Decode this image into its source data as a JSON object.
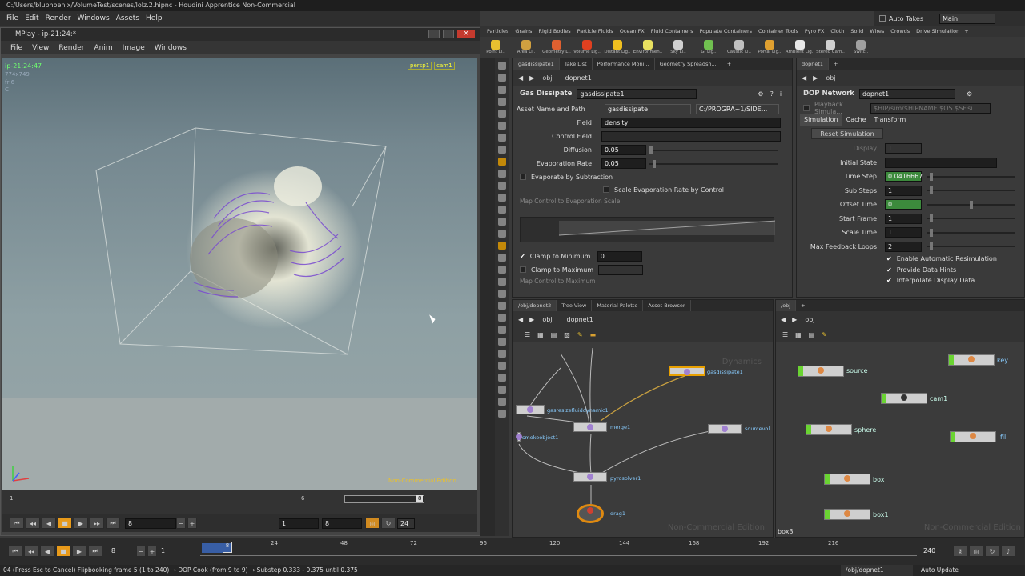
{
  "window": {
    "title": "C:/Users/bluphoenix/VolumeTest/scenes/lolz.2.hipnc - Houdini Apprentice Non-Commercial"
  },
  "menu": [
    "File",
    "Edit",
    "Render",
    "Windows",
    "Assets",
    "Help"
  ],
  "takes": {
    "auto_takes": "Auto Takes",
    "desktop": "Main"
  },
  "shelf_tabs": [
    "Particles",
    "Grains",
    "Rigid Bodies",
    "Particle Fluids",
    "Ocean FX",
    "Fluid Containers",
    "Populate Containers",
    "Container Tools",
    "Pyro FX",
    "Cloth",
    "Solid",
    "Wires",
    "Crowds",
    "Drive Simulation"
  ],
  "shelf_tools": [
    "Point Li..",
    "Area Li..",
    "Geometry L..",
    "Volume Lig..",
    "Distant Lig..",
    "Environmen..",
    "Sky Li..",
    "GI Lig..",
    "Caustic Li..",
    "Portal Lig..",
    "Ambient Lig..",
    "Stereo Cam..",
    "Switc.."
  ],
  "mplay": {
    "title": "MPlay - ip-21:24:*",
    "menu": [
      "File",
      "View",
      "Render",
      "Anim",
      "Image",
      "Windows"
    ],
    "viewport": {
      "image_name": "ip-21:24:47",
      "resolution": "774x749",
      "frame": "fr 6",
      "channel": "C",
      "persp": "persp1",
      "cam": "cam1",
      "watermark": "Non-Commercial Edition"
    },
    "timeline": {
      "start": "1",
      "mid": "6",
      "end_marker": "8"
    },
    "controls": {
      "frame": "8",
      "range_start": "1",
      "range_end": "8",
      "fps": "24"
    }
  },
  "parm_pane": {
    "tabs": [
      "gasdissipate1",
      "Take List",
      "Performance Moni...",
      "Geometry Spreadsh..."
    ],
    "path": {
      "root": "obj",
      "node": "dopnet1"
    },
    "node_type": "Gas Dissipate",
    "node_name": "gasdissipate1",
    "asset": {
      "label": "Asset Name and Path",
      "name": "gasdissipate",
      "path": "C:/PROGRA~1/SIDE..."
    },
    "parms": [
      {
        "label": "Field",
        "value": "density"
      },
      {
        "label": "Control Field",
        "value": ""
      },
      {
        "label": "Diffusion",
        "value": "0.05"
      },
      {
        "label": "Evaporation Rate",
        "value": "0.05"
      }
    ],
    "evap_subtraction": "Evaporate by Subtraction",
    "scale_evap": "Scale Evaporation Rate by Control",
    "map_evap": "Map Control to Evaporation Scale",
    "clamp_min": {
      "label": "Clamp to Minimum",
      "value": "0"
    },
    "clamp_max": {
      "label": "Clamp to Maximum",
      "value": ""
    },
    "map_max": "Map Control to Maximum"
  },
  "dop_pane": {
    "tab": "dopnet1",
    "path": {
      "root": "obj"
    },
    "node_type": "DOP Network",
    "node_name": "dopnet1",
    "playback": "Playback Simula...",
    "playback_path": "$HIP/sim/$HIPNAME.$OS.$SF.si",
    "tabs": [
      "Simulation",
      "Cache",
      "Transform"
    ],
    "reset": "Reset Simulation",
    "parms": [
      {
        "label": "Display",
        "value": "1"
      },
      {
        "label": "Initial State",
        "value": ""
      },
      {
        "label": "Time Step",
        "value": "0.0416667"
      },
      {
        "label": "Sub Steps",
        "value": "1"
      },
      {
        "label": "Offset Time",
        "value": "0"
      },
      {
        "label": "Start Frame",
        "value": "1"
      },
      {
        "label": "Scale Time",
        "value": "1"
      },
      {
        "label": "Max Feedback Loops",
        "value": "2"
      }
    ],
    "checks": [
      "Enable Automatic Resimulation",
      "Provide Data Hints",
      "Interpolate Display Data"
    ]
  },
  "net_left": {
    "tabs": [
      "/obj/dopnet2",
      "Tree View",
      "Material Palette",
      "Asset Browser"
    ],
    "path": {
      "root": "obj",
      "node": "dopnet1"
    },
    "context": "Dynamics",
    "watermark": "Non-Commercial Edition",
    "nodes": [
      "gasdissipate1",
      "gasresizefluiddynamic1",
      "smokeobject1",
      "merge1",
      "sourcevol",
      "pyrosolver1",
      "drag1"
    ]
  },
  "net_right": {
    "tab": "/obj",
    "path": {
      "root": "obj"
    },
    "watermark": "Non-Commercial Edition",
    "nodes": [
      "source",
      "key",
      "cam1",
      "sphere",
      "fill",
      "box",
      "box1"
    ],
    "bottom_label": "box3"
  },
  "timeline": {
    "frame": "8",
    "start": "1",
    "end": "240",
    "ticks": [
      "24",
      "48",
      "72",
      "96",
      "120",
      "144",
      "168",
      "192",
      "216"
    ],
    "current": "8"
  },
  "status": {
    "message": "04 (Press Esc to Cancel) Flipbooking frame 5 (1 to 240) → DOP Cook (from 9 to 9) → Substep 0.333 - 0.375 until 0.375",
    "path": "/obj/dopnet1",
    "update": "Auto Update"
  },
  "colors": {
    "accent_green": "#6ad432",
    "selection": "#e8a000",
    "volume": "#7a4bd0"
  }
}
